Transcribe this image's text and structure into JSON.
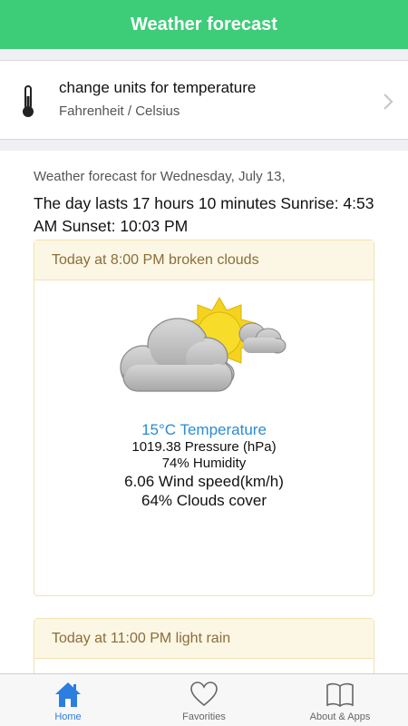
{
  "header": {
    "title": "Weather forecast"
  },
  "settings": {
    "title": "change units for temperature",
    "subtitle": "Fahrenheit / Celsius",
    "icon": "thermometer-icon"
  },
  "forecast": {
    "date_line": "Weather forecast for Wednesday, July 13,",
    "day_info": "The day lasts 17 hours 10 minutes Sunrise: 4:53 AM Sunset: 10:03 PM",
    "cards": [
      {
        "title": "Today at 8:00 PM broken clouds",
        "icon": "broken-clouds-icon",
        "temperature": "15°C Temperature",
        "pressure": "1019.38 Pressure (hPa)",
        "humidity": "74% Humidity",
        "wind": "6.06 Wind speed(km/h)",
        "clouds": "64% Clouds cover"
      },
      {
        "title": "Today at 11:00 PM light rain"
      }
    ]
  },
  "tabs": [
    {
      "label": "Home",
      "icon": "home-icon",
      "active": true
    },
    {
      "label": "Favorities",
      "icon": "heart-icon",
      "active": false
    },
    {
      "label": "About & Apps",
      "icon": "book-icon",
      "active": false
    }
  ],
  "colors": {
    "header": "#3dcc78",
    "active_tab": "#2e7de1",
    "temperature": "#2a8bd4",
    "card_header_bg": "#fcf7e4",
    "card_header_text": "#8a6d3b"
  }
}
